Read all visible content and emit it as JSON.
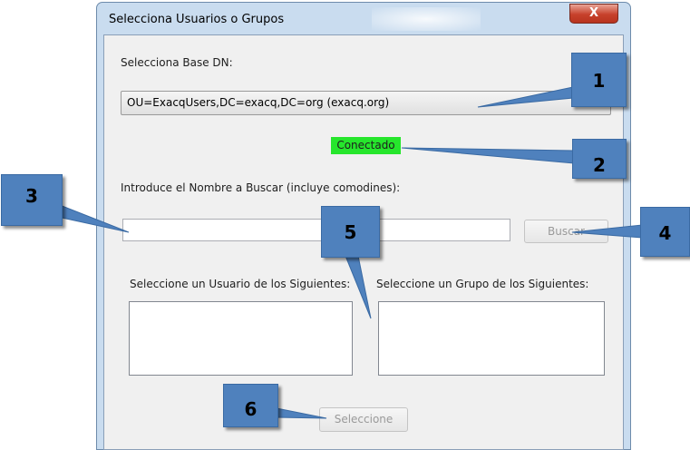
{
  "window": {
    "title": "Selecciona Usuarios o Grupos",
    "close_glyph": "X"
  },
  "form": {
    "base_dn_label": "Selecciona Base DN:",
    "base_dn_value": "OU=ExacqUsers,DC=exacq,DC=org (exacq.org)",
    "dropdown_arrow": "▼",
    "status_text": "Conectado",
    "search_label": "Introduce el Nombre a Buscar (incluye comodines):",
    "search_value": "",
    "search_button": "Buscar",
    "users_label": "Seleccione un Usuario de los Siguientes:",
    "groups_label": "Seleccione un Grupo de los Siguientes:",
    "select_button": "Seleccione"
  },
  "callouts": [
    "1",
    "2",
    "3",
    "4",
    "5",
    "6"
  ],
  "colors": {
    "status_bg": "#26e62c",
    "callout_fill": "#4f81bd",
    "frame": "#c9dcef",
    "close_button": "#c7412b"
  }
}
